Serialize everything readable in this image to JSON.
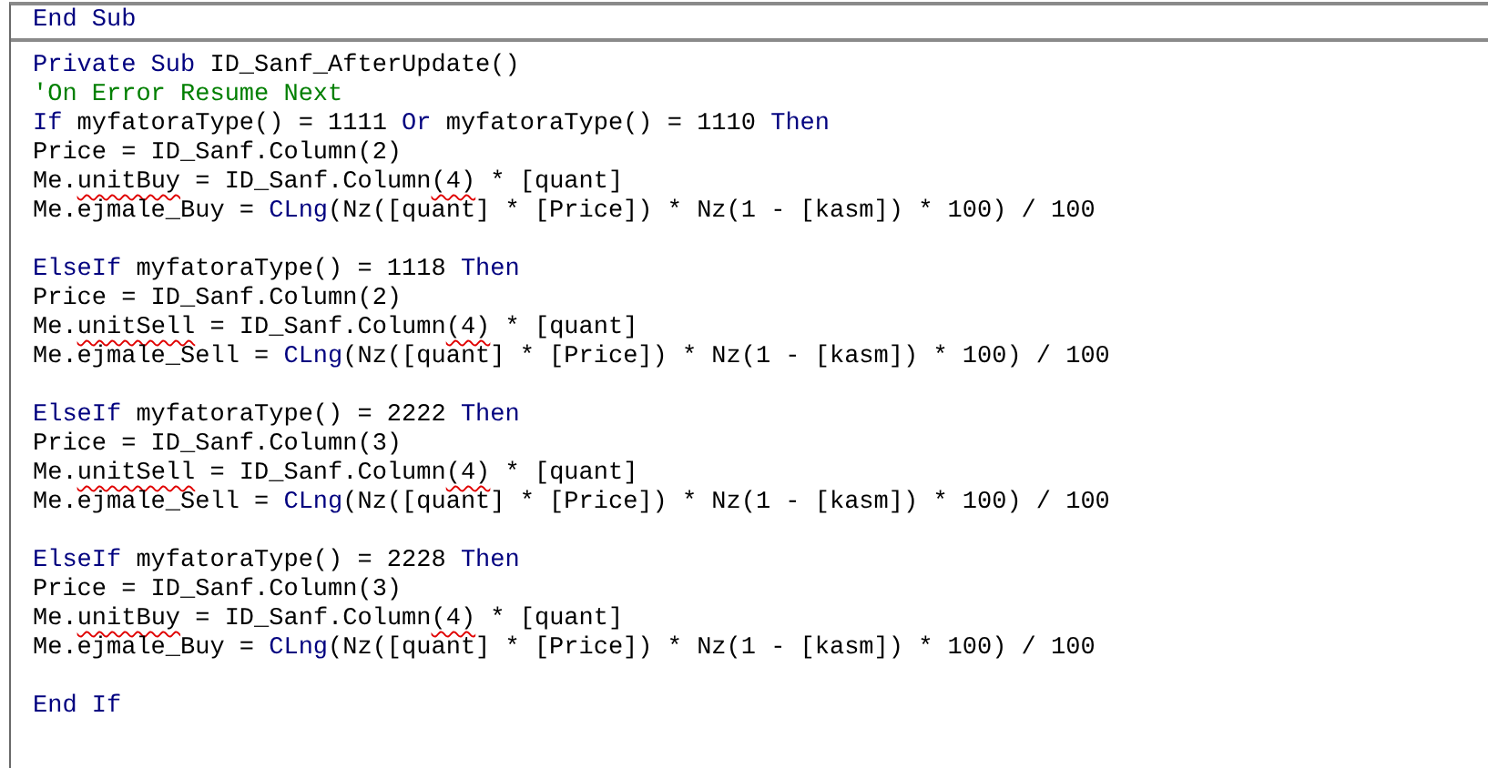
{
  "header_line": [
    {
      "text": "End Sub",
      "kind": "kw"
    }
  ],
  "blocks": [
    {
      "lines": [
        [
          {
            "text": "Private Sub",
            "kind": "kw"
          },
          {
            "text": " ID_Sanf_AfterUpdate()",
            "kind": "plain"
          }
        ],
        [
          {
            "text": "'On Error Resume Next",
            "kind": "comment"
          }
        ],
        [
          {
            "text": "If",
            "kind": "kw"
          },
          {
            "text": " myfatoraType() = 1111 ",
            "kind": "plain"
          },
          {
            "text": "Or",
            "kind": "kw"
          },
          {
            "text": " myfatoraType() = 1110 ",
            "kind": "plain"
          },
          {
            "text": "Then",
            "kind": "kw"
          }
        ],
        [
          {
            "text": "Price = ID_Sanf.Column(2)",
            "kind": "plain"
          }
        ],
        [
          {
            "text": "Me.",
            "kind": "plain"
          },
          {
            "text": "unitBuy",
            "kind": "marked"
          },
          {
            "text": " = ID_Sanf.Column",
            "kind": "plain"
          },
          {
            "text": "(4)",
            "kind": "marked"
          },
          {
            "text": " * [quant]",
            "kind": "plain"
          }
        ],
        [
          {
            "text": "Me.ejmale_Buy = ",
            "kind": "plain"
          },
          {
            "text": "CLng",
            "kind": "kw"
          },
          {
            "text": "(Nz([quant] * [Price]) * Nz(1 - [kasm]) * 100) / 100",
            "kind": "plain"
          }
        ]
      ]
    },
    {
      "lines": [
        [
          {
            "text": "ElseIf",
            "kind": "kw"
          },
          {
            "text": " myfatoraType() = 1118 ",
            "kind": "plain"
          },
          {
            "text": "Then",
            "kind": "kw"
          }
        ],
        [
          {
            "text": "Price = ID_Sanf.Column(2)",
            "kind": "plain"
          }
        ],
        [
          {
            "text": "Me.",
            "kind": "plain"
          },
          {
            "text": "unitSell",
            "kind": "marked"
          },
          {
            "text": " = ID_Sanf.Column",
            "kind": "plain"
          },
          {
            "text": "(4)",
            "kind": "marked"
          },
          {
            "text": " * [quant]",
            "kind": "plain"
          }
        ],
        [
          {
            "text": "Me.ejmale_Sell = ",
            "kind": "plain"
          },
          {
            "text": "CLng",
            "kind": "kw"
          },
          {
            "text": "(Nz([quant] * [Price]) * Nz(1 - [kasm]) * 100) / 100",
            "kind": "plain"
          }
        ]
      ]
    },
    {
      "lines": [
        [
          {
            "text": "ElseIf",
            "kind": "kw"
          },
          {
            "text": " myfatoraType() = 2222 ",
            "kind": "plain"
          },
          {
            "text": "Then",
            "kind": "kw"
          }
        ],
        [
          {
            "text": "Price = ID_Sanf.Column(3)",
            "kind": "plain"
          }
        ],
        [
          {
            "text": "Me.",
            "kind": "plain"
          },
          {
            "text": "unitSell",
            "kind": "marked"
          },
          {
            "text": " = ID_Sanf.Column",
            "kind": "plain"
          },
          {
            "text": "(4)",
            "kind": "marked"
          },
          {
            "text": " * [quant]",
            "kind": "plain"
          }
        ],
        [
          {
            "text": "Me.ejmale_Sell = ",
            "kind": "plain"
          },
          {
            "text": "CLng",
            "kind": "kw"
          },
          {
            "text": "(Nz([quant] * [Price]) * Nz(1 - [kasm]) * 100) / 100",
            "kind": "plain"
          }
        ]
      ]
    },
    {
      "lines": [
        [
          {
            "text": "ElseIf",
            "kind": "kw"
          },
          {
            "text": " myfatoraType() = 2228 ",
            "kind": "plain"
          },
          {
            "text": "Then",
            "kind": "kw"
          }
        ],
        [
          {
            "text": "Price = ID_Sanf.Column(3)",
            "kind": "plain"
          }
        ],
        [
          {
            "text": "Me.",
            "kind": "plain"
          },
          {
            "text": "unitBuy",
            "kind": "marked"
          },
          {
            "text": " = ID_Sanf.Column",
            "kind": "plain"
          },
          {
            "text": "(4)",
            "kind": "marked"
          },
          {
            "text": " * [quant]",
            "kind": "plain"
          }
        ],
        [
          {
            "text": "Me.ejmale_Buy = ",
            "kind": "plain"
          },
          {
            "text": "CLng",
            "kind": "kw"
          },
          {
            "text": "(Nz([quant] * [Price]) * Nz(1 - [kasm]) * 100) / 100",
            "kind": "plain"
          }
        ]
      ]
    },
    {
      "lines": [
        [
          {
            "text": "End If",
            "kind": "kw"
          }
        ]
      ]
    }
  ]
}
